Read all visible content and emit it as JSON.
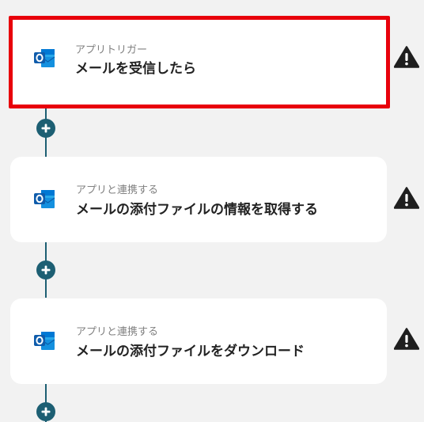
{
  "colors": {
    "connector": "#1d5f73",
    "selected_border": "#e8000b",
    "card_background": "#ffffff",
    "page_background": "#f2f2f2"
  },
  "steps": [
    {
      "subtitle": "アプリトリガー",
      "title": "メールを受信したら",
      "app_icon": "outlook-icon",
      "selected": true,
      "warning_icon": "warning-icon"
    },
    {
      "subtitle": "アプリと連携する",
      "title": "メールの添付ファイルの情報を取得する",
      "app_icon": "outlook-icon",
      "selected": false,
      "warning_icon": "warning-icon"
    },
    {
      "subtitle": "アプリと連携する",
      "title": "メールの添付ファイルをダウンロード",
      "app_icon": "outlook-icon",
      "selected": false,
      "warning_icon": "warning-icon"
    }
  ],
  "add_step_icon": "plus-icon"
}
